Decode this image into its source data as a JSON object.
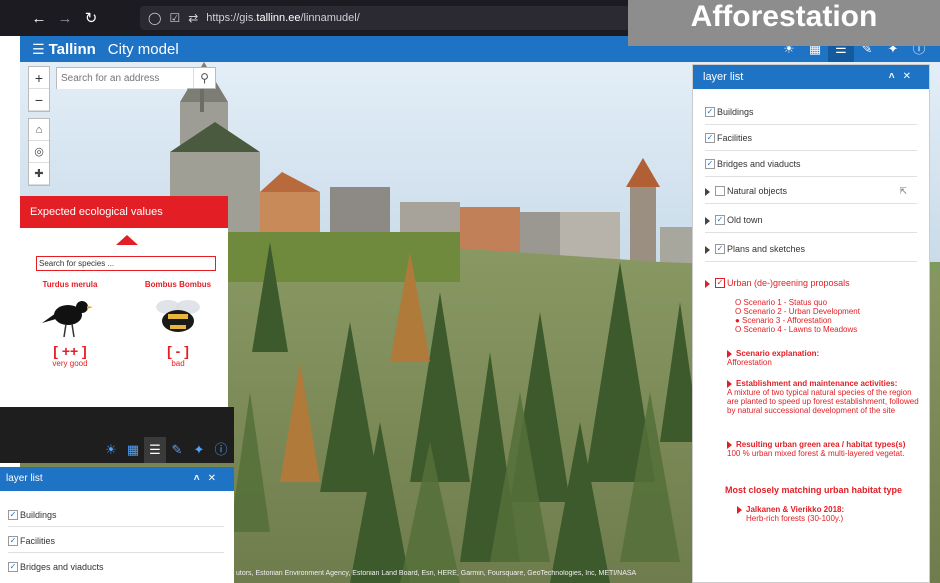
{
  "browser": {
    "url_prefix": "https://gis.",
    "url_domain": "tallinn.ee",
    "url_path": "/linnamudel/"
  },
  "overlay_title": "Afforestation",
  "app": {
    "brand": "Tallinn",
    "title": "City model"
  },
  "search": {
    "placeholder": "Search for an address"
  },
  "eco_panel": {
    "title": "Expected ecological values",
    "search_placeholder": "Search for species ...",
    "species": [
      {
        "name": "Turdus merula",
        "rating": "[ ++ ]",
        "label": "very good"
      },
      {
        "name": "Bombus Bombus",
        "rating": "[ - ]",
        "label": "bad"
      }
    ]
  },
  "layer_list": {
    "title": "layer list",
    "items": [
      {
        "label": "Buildings",
        "checked": true
      },
      {
        "label": "Facilities",
        "checked": true
      },
      {
        "label": "Bridges and viaducts",
        "checked": true
      },
      {
        "label": "Natural objects",
        "checked": false
      },
      {
        "label": "Old town",
        "checked": true
      },
      {
        "label": "Plans and sketches",
        "checked": true
      },
      {
        "label": "Urban (de-)greening proposals",
        "checked": true
      }
    ],
    "scenarios": [
      "O Scenario 1 - Status quo",
      "O Scenario 2 - Urban Development",
      "● Scenario 3 - Afforestation",
      "O Scenario 4 - Lawns to Meadows"
    ],
    "explanation_head": "Scenario explanation:",
    "explanation_text": "Afforestation",
    "establishment_head": "Establishment and maintenance activities:",
    "establishment_text": "A mixture of two typical natural species of the region are planted to speed up forest establishment, followed by natural successional development of the site",
    "result_head": "Resulting urban green area / habitat types(s)",
    "result_text": "100 % urban mixed forest & multi-layered vegetat.",
    "habitat_title": "Most closely matching urban habitat type",
    "habitat_head": "Jalkanen & Vierikko 2018:",
    "habitat_text": "Herb-rich forests (30-100y.)"
  },
  "bottom_widget": {
    "title": "layer list",
    "items": [
      "Buildings",
      "Facilities",
      "Bridges and viaducts"
    ]
  },
  "attribution": "utors, Estonian Environment Agency, Estonian Land Board, Esri, HERE, Garmin, Foursquare, GeoTechnologies, Inc, METI/NASA"
}
